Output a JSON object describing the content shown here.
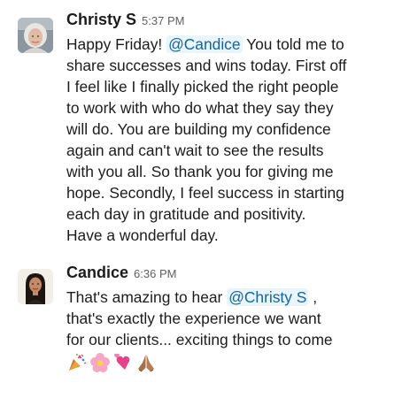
{
  "messages": [
    {
      "author": "Christy S",
      "time": "5:37 PM",
      "lines": {
        "l1_pre": "Happy Friday! ",
        "l1_mention": "@Candice",
        "l1_post": " You told me to",
        "l2": "share successes and wins today. First off",
        "l3": "I feel like I finally picked the right people",
        "l4": "to work with who do what they say they",
        "l5": "will do. You are building my confidence",
        "l6": "again and can't wait to see the results",
        "l7": "with you all. So thank you for giving me",
        "l8": "hope. Secondly, I feel success in starting",
        "l9": "each day in gratitude and positivity.",
        "l10": "Have a wonderful day."
      }
    },
    {
      "author": "Candice",
      "time": "6:36 PM",
      "lines": {
        "l1_pre": "That's amazing to hear ",
        "l1_mention": "@Christy S",
        "l1_post": " ,",
        "l2": "that's exactly the experience we want",
        "l3": "for our clients... exciting things to come"
      },
      "emojis": [
        "party-popper-emoji",
        "pink-flower-emoji",
        "two-hearts-emoji",
        "folded-hands-emoji"
      ]
    }
  ],
  "colors": {
    "mention_bg": "#e8f5fa",
    "mention_text": "#1264a3",
    "timestamp": "#616061"
  }
}
